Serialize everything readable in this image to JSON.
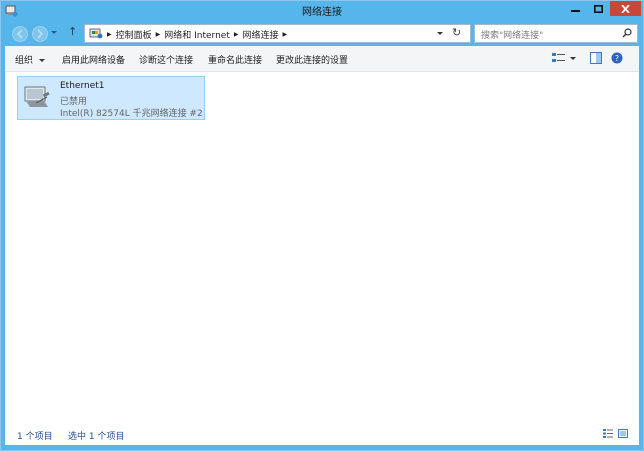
{
  "window": {
    "title": "网络连接"
  },
  "address": {
    "crumbs": [
      "控制面板",
      "网络和 Internet",
      "网络连接"
    ],
    "search_placeholder": "搜索\"网络连接\""
  },
  "toolbar": {
    "organize": "组织",
    "enable_device": "启用此网络设备",
    "diagnose": "诊断这个连接",
    "rename": "重命名此连接",
    "change_settings": "更改此连接的设置"
  },
  "connections": [
    {
      "name": "Ethernet1",
      "status": "已禁用",
      "device": "Intel(R) 82574L 千兆网络连接 #2"
    }
  ],
  "statusbar": {
    "item_count": "1 个项目",
    "selected": "选中 1 个项目"
  },
  "colors": {
    "titlebar": "#56b5ea",
    "close": "#c7473b",
    "selection": "#cde8ff"
  }
}
